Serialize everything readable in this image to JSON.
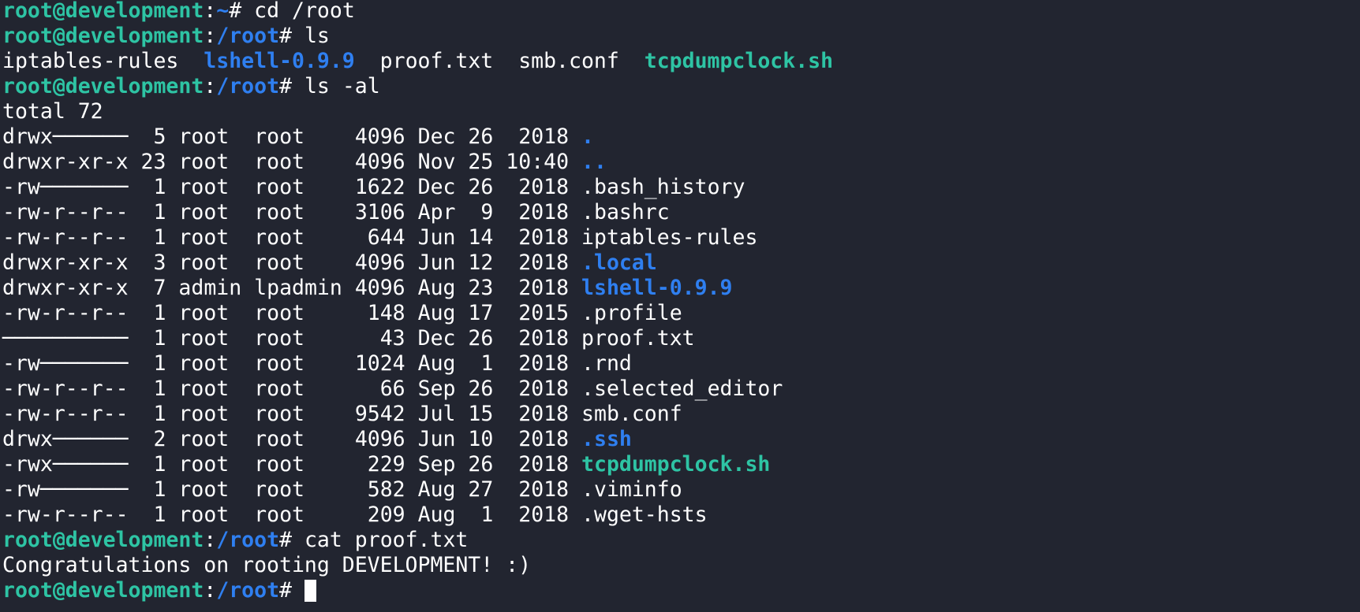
{
  "prompt": {
    "host": "root@development",
    "sep": ":",
    "home_path": "~",
    "root_path": "/root",
    "symbol": "#"
  },
  "commands": {
    "cd": "cd /root",
    "ls": "ls",
    "ls_al": "ls -al",
    "cat": "cat proof.txt",
    "current": ""
  },
  "ls_short": [
    {
      "name": "iptables-rules",
      "type": "file"
    },
    {
      "name": "lshell-0.9.9",
      "type": "dir"
    },
    {
      "name": "proof.txt",
      "type": "file"
    },
    {
      "name": "smb.conf",
      "type": "file"
    },
    {
      "name": "tcpdumpclock.sh",
      "type": "exe"
    }
  ],
  "ls_total": "total 72",
  "ls_long": [
    {
      "perms": "drwx──────",
      "links": " 5",
      "owner": "root ",
      "group": "root   ",
      "size": "4096",
      "date": "Dec 26  2018",
      "name": ".",
      "type": "dir"
    },
    {
      "perms": "drwxr-xr-x",
      "links": "23",
      "owner": "root ",
      "group": "root   ",
      "size": "4096",
      "date": "Nov 25 10:40",
      "name": "..",
      "type": "dir"
    },
    {
      "perms": "-rw───────",
      "links": " 1",
      "owner": "root ",
      "group": "root   ",
      "size": "1622",
      "date": "Dec 26  2018",
      "name": ".bash_history",
      "type": "file"
    },
    {
      "perms": "-rw-r--r--",
      "links": " 1",
      "owner": "root ",
      "group": "root   ",
      "size": "3106",
      "date": "Apr  9  2018",
      "name": ".bashrc",
      "type": "file"
    },
    {
      "perms": "-rw-r--r--",
      "links": " 1",
      "owner": "root ",
      "group": "root   ",
      "size": " 644",
      "date": "Jun 14  2018",
      "name": "iptables-rules",
      "type": "file"
    },
    {
      "perms": "drwxr-xr-x",
      "links": " 3",
      "owner": "root ",
      "group": "root   ",
      "size": "4096",
      "date": "Jun 12  2018",
      "name": ".local",
      "type": "dir"
    },
    {
      "perms": "drwxr-xr-x",
      "links": " 7",
      "owner": "admin",
      "group": "lpadmin",
      "size": "4096",
      "date": "Aug 23  2018",
      "name": "lshell-0.9.9",
      "type": "dir"
    },
    {
      "perms": "-rw-r--r--",
      "links": " 1",
      "owner": "root ",
      "group": "root   ",
      "size": " 148",
      "date": "Aug 17  2015",
      "name": ".profile",
      "type": "file"
    },
    {
      "perms": "──────────",
      "links": " 1",
      "owner": "root ",
      "group": "root   ",
      "size": "  43",
      "date": "Dec 26  2018",
      "name": "proof.txt",
      "type": "file"
    },
    {
      "perms": "-rw───────",
      "links": " 1",
      "owner": "root ",
      "group": "root   ",
      "size": "1024",
      "date": "Aug  1  2018",
      "name": ".rnd",
      "type": "file"
    },
    {
      "perms": "-rw-r--r--",
      "links": " 1",
      "owner": "root ",
      "group": "root   ",
      "size": "  66",
      "date": "Sep 26  2018",
      "name": ".selected_editor",
      "type": "file"
    },
    {
      "perms": "-rw-r--r--",
      "links": " 1",
      "owner": "root ",
      "group": "root   ",
      "size": "9542",
      "date": "Jul 15  2018",
      "name": "smb.conf",
      "type": "file"
    },
    {
      "perms": "drwx──────",
      "links": " 2",
      "owner": "root ",
      "group": "root   ",
      "size": "4096",
      "date": "Jun 10  2018",
      "name": ".ssh",
      "type": "dir"
    },
    {
      "perms": "-rwx──────",
      "links": " 1",
      "owner": "root ",
      "group": "root   ",
      "size": " 229",
      "date": "Sep 26  2018",
      "name": "tcpdumpclock.sh",
      "type": "exe"
    },
    {
      "perms": "-rw───────",
      "links": " 1",
      "owner": "root ",
      "group": "root   ",
      "size": " 582",
      "date": "Aug 27  2018",
      "name": ".viminfo",
      "type": "file"
    },
    {
      "perms": "-rw-r--r--",
      "links": " 1",
      "owner": "root ",
      "group": "root   ",
      "size": " 209",
      "date": "Aug  1  2018",
      "name": ".wget-hsts",
      "type": "file"
    }
  ],
  "cat_output": "Congratulations on rooting DEVELOPMENT! :)",
  "colors": {
    "background": "#222530",
    "text": "#ffffff",
    "prompt_host": "#2ec4a4",
    "prompt_path": "#2f7ff0",
    "directory": "#2f7ff0",
    "executable": "#2ec4a4"
  }
}
